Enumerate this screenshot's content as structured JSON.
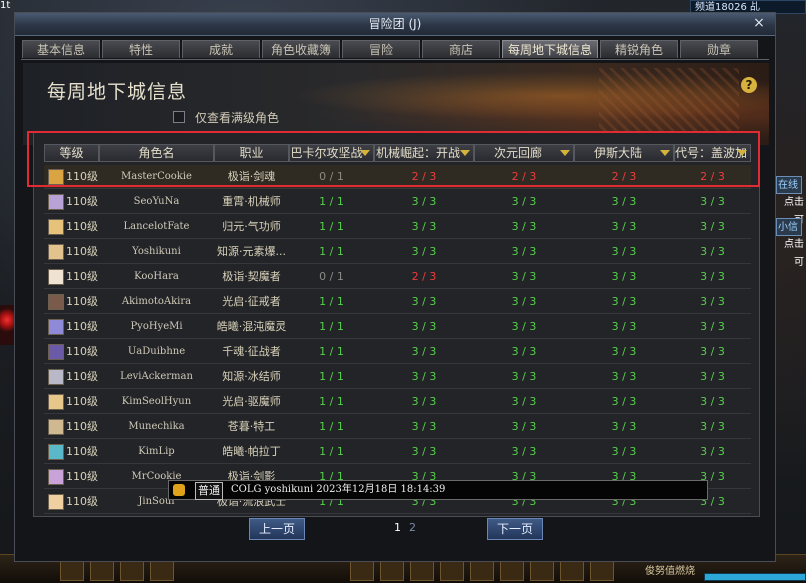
{
  "top_left_text": "1t",
  "channel_label": "频道18026 乩",
  "right_side": [
    "在线",
    "点击可",
    "小信",
    "点击可"
  ],
  "window": {
    "title": "冒险团 (J)",
    "close_label": "×"
  },
  "tabs": [
    {
      "label": "基本信息",
      "active": false
    },
    {
      "label": "特性",
      "active": false
    },
    {
      "label": "成就",
      "active": false
    },
    {
      "label": "角色收藏簿",
      "active": false
    },
    {
      "label": "冒险",
      "active": false
    },
    {
      "label": "商店",
      "active": false
    },
    {
      "label": "每周地下城信息",
      "active": true
    },
    {
      "label": "精锐角色",
      "active": false
    },
    {
      "label": "勋章",
      "active": false
    }
  ],
  "page": {
    "heading": "每周地下城信息",
    "help_icon_label": "?",
    "checkbox_label": "仅查看满级角色"
  },
  "table": {
    "headers": [
      "等级",
      "角色名",
      "职业",
      "巴卡尔攻坚战",
      "机械崛起：开战",
      "次元回廊",
      "伊斯大陆",
      "代号：盖波加"
    ],
    "rows": [
      {
        "level": "110级",
        "name": "MasterCookie",
        "job": "极诣·剑魂",
        "c1": "0 / 1",
        "c2": "2 / 3",
        "c3": "2 / 3",
        "c4": "2 / 3",
        "c5": "2 / 3",
        "avatar_color": "#d9a441"
      },
      {
        "level": "110级",
        "name": "SeoYuNa",
        "job": "重霄·机械师",
        "c1": "1 / 1",
        "c2": "3 / 3",
        "c3": "3 / 3",
        "c4": "3 / 3",
        "c5": "3 / 3",
        "avatar_color": "#b9a3d6"
      },
      {
        "level": "110级",
        "name": "LancelotFate",
        "job": "归元·气功师",
        "c1": "1 / 1",
        "c2": "3 / 3",
        "c3": "3 / 3",
        "c4": "3 / 3",
        "c5": "3 / 3",
        "avatar_color": "#e6c27a"
      },
      {
        "level": "110级",
        "name": "Yoshikuni",
        "job": "知源·元素爆...",
        "c1": "1 / 1",
        "c2": "3 / 3",
        "c3": "3 / 3",
        "c4": "3 / 3",
        "c5": "3 / 3",
        "avatar_color": "#e2c38e"
      },
      {
        "level": "110级",
        "name": "KooHara",
        "job": "极诣·契魔者",
        "c1": "0 / 1",
        "c2": "2 / 3",
        "c3": "3 / 3",
        "c4": "3 / 3",
        "c5": "3 / 3",
        "avatar_color": "#f0e2d2"
      },
      {
        "level": "110级",
        "name": "AkimotoAkira",
        "job": "光启·征戒者",
        "c1": "1 / 1",
        "c2": "3 / 3",
        "c3": "3 / 3",
        "c4": "3 / 3",
        "c5": "3 / 3",
        "avatar_color": "#7a5a4a"
      },
      {
        "level": "110级",
        "name": "PyoHyeMi",
        "job": "皓曦·混沌魔灵",
        "c1": "1 / 1",
        "c2": "3 / 3",
        "c3": "3 / 3",
        "c4": "3 / 3",
        "c5": "3 / 3",
        "avatar_color": "#8f8ad8"
      },
      {
        "level": "110级",
        "name": "UaDuibhne",
        "job": "千魂·征战者",
        "c1": "1 / 1",
        "c2": "3 / 3",
        "c3": "3 / 3",
        "c4": "3 / 3",
        "c5": "3 / 3",
        "avatar_color": "#6a5aa8"
      },
      {
        "level": "110级",
        "name": "LeviAckerman",
        "job": "知源·冰结师",
        "c1": "1 / 1",
        "c2": "3 / 3",
        "c3": "3 / 3",
        "c4": "3 / 3",
        "c5": "3 / 3",
        "avatar_color": "#b8b8c8"
      },
      {
        "level": "110级",
        "name": "KimSeolHyun",
        "job": "光启·驱魔师",
        "c1": "1 / 1",
        "c2": "3 / 3",
        "c3": "3 / 3",
        "c4": "3 / 3",
        "c5": "3 / 3",
        "avatar_color": "#e8c88a"
      },
      {
        "level": "110级",
        "name": "Munechika",
        "job": "苍暮·特工",
        "c1": "1 / 1",
        "c2": "3 / 3",
        "c3": "3 / 3",
        "c4": "3 / 3",
        "c5": "3 / 3",
        "avatar_color": "#d0b890"
      },
      {
        "level": "110级",
        "name": "KimLip",
        "job": "皓曦·帕拉丁",
        "c1": "1 / 1",
        "c2": "3 / 3",
        "c3": "3 / 3",
        "c4": "3 / 3",
        "c5": "3 / 3",
        "avatar_color": "#5ab8c8"
      },
      {
        "level": "110级",
        "name": "MrCookie",
        "job": "极诣·剑影",
        "c1": "1 / 1",
        "c2": "3 / 3",
        "c3": "3 / 3",
        "c4": "3 / 3",
        "c5": "3 / 3",
        "avatar_color": "#c8a2d8"
      },
      {
        "level": "110级",
        "name": "JinSoul",
        "job": "极诣·流浪武士",
        "c1": "1 / 1",
        "c2": "3 / 3",
        "c3": "3 / 3",
        "c4": "3 / 3",
        "c5": "3 / 3",
        "avatar_color": "#f0d0a0"
      }
    ]
  },
  "pager": {
    "prev_label": "上一页",
    "next_label": "下一页",
    "pages": [
      "1",
      "2"
    ],
    "current": "1"
  },
  "chat": {
    "channel": "普通",
    "message": "COLG yoshikuni 2023年12月18日 18:14:39"
  },
  "bottom_bar_text": "俊努值燃烧",
  "colors": {
    "done": "#55d04a",
    "partial": "#ef3c3c",
    "none": "#8c8a85",
    "highlight": "#e02a34"
  }
}
